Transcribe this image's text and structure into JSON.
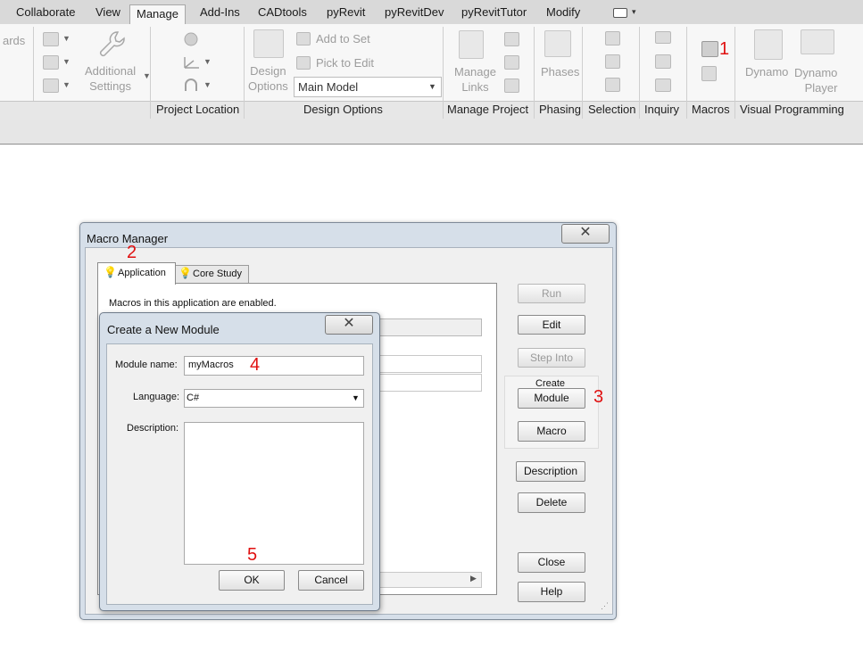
{
  "ribbon": {
    "tabs": [
      "Collaborate",
      "View",
      "Manage",
      "Add-Ins",
      "CADtools",
      "pyRevit",
      "pyRevitDev",
      "pyRevitTutor",
      "Modify"
    ],
    "active_tab": "Manage",
    "left_cut_text": "ards",
    "additional_settings": "Additional\nSettings",
    "design_options": "Design\nOptions",
    "add_to_set": "Add to Set",
    "pick_to_edit": "Pick to Edit",
    "main_model": "Main Model",
    "manage_links": "Manage\nLinks",
    "phases": "Phases",
    "dynamo": "Dynamo",
    "dynamo_player": "Dynamo\nPlayer",
    "panels": [
      "Project Location",
      "Design Options",
      "Manage Project",
      "Phasing",
      "Selection",
      "Inquiry",
      "Macros",
      "Visual Programming"
    ]
  },
  "annotations": {
    "n1": "1",
    "n2": "2",
    "n3": "3",
    "n4": "4",
    "n5": "5"
  },
  "macro_manager": {
    "title": "Macro Manager",
    "tabs": [
      "Application",
      "Core Study"
    ],
    "enabled_text": "Macros in this application are enabled.",
    "buttons": {
      "run": "Run",
      "edit": "Edit",
      "step_into": "Step Into",
      "create_label": "Create",
      "module": "Module",
      "macro": "Macro",
      "description": "Description",
      "delete": "Delete",
      "close": "Close",
      "help": "Help"
    }
  },
  "new_module": {
    "title": "Create a New Module",
    "module_name_label": "Module name:",
    "module_name_value": "myMacros",
    "language_label": "Language:",
    "language_value": "C#",
    "description_label": "Description:",
    "ok": "OK",
    "cancel": "Cancel"
  },
  "colors": {
    "annotation_red": "#e01010",
    "dialog_frame": "#d6dfe9"
  }
}
